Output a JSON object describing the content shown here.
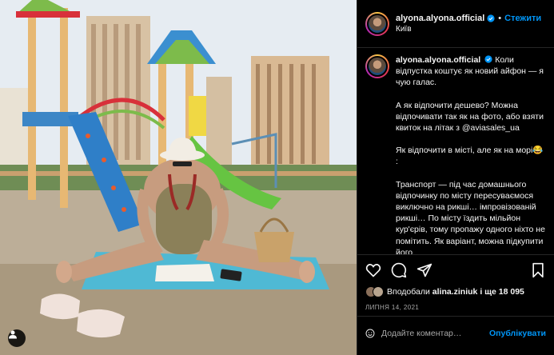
{
  "post": {
    "username": "alyona.alyona.official",
    "location": "Київ",
    "follow_label": "Стежити",
    "separator": "•",
    "caption_paragraphs": [
      "Коли відпустка коштує як новий айфон — я чую галас.",
      "А як відпочити дешево? Можна відпочивати так як на фото, або взяти квиток на літак з @aviasales_ua",
      "Як відпочити в місті, але як на морі😂 :",
      "Транспорт — під час домашнього відпочинку по місту пересуваємося виключно на рикші… імпровізованій рикші… По місту їздить мільйон кур'єрів, тому пропажу одного ніхто не помітить. Як варіант, можна підкупити його"
    ],
    "likes": {
      "prefix": "Вподобали",
      "user": "alina.ziniuk",
      "suffix": "і ще 18 095"
    },
    "date": "ЛИПНЯ 14, 2021",
    "comment_placeholder": "Додайте коментар…",
    "publish_label": "Опублікувати"
  },
  "icons": {
    "like": "heart-icon",
    "comment": "comment-icon",
    "share": "share-icon",
    "save": "bookmark-icon",
    "emoji": "smiley-icon",
    "verified": "verified-badge-icon",
    "user_tags": "user-tag-icon"
  },
  "colors": {
    "accent": "#0095f6",
    "background": "#000000",
    "text": "#f5f5f5",
    "muted": "#a8a8a8",
    "divider": "#262626"
  }
}
